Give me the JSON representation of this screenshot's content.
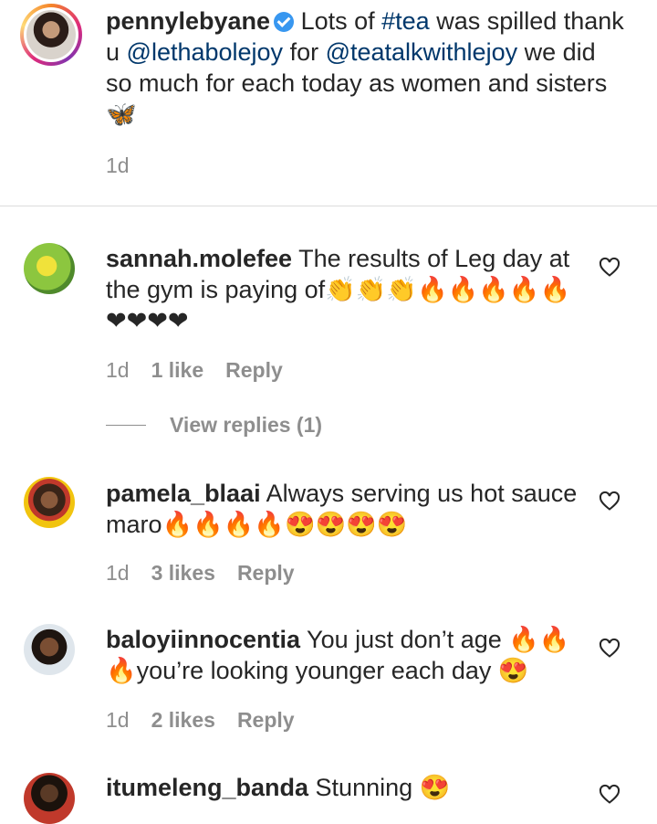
{
  "post": {
    "username": "pennylebyane",
    "caption_part1": " Lots of ",
    "hashtag": "#tea",
    "caption_part2": " was spilled thank u ",
    "mention1": "@lethabolejoy",
    "caption_part3": " for ",
    "mention2": "@teatalkwithlejoy",
    "caption_part4": " we did so much for each today as women and sisters 🦋",
    "time": "1d"
  },
  "comments": [
    {
      "username": "sannah.molefee",
      "text": " The results of Leg day at the gym is paying of👏👏👏🔥🔥🔥🔥🔥❤❤❤❤",
      "time": "1d",
      "likes": "1 like",
      "reply": "Reply",
      "view_replies": "View replies (1)"
    },
    {
      "username": "pamela_blaai",
      "text": " Always serving us hot sauce maro🔥🔥🔥🔥😍😍😍😍",
      "time": "1d",
      "likes": "3 likes",
      "reply": "Reply"
    },
    {
      "username": "baloyiinnocentia",
      "text": " You just don’t age 🔥🔥🔥you’re looking younger each day 😍",
      "time": "1d",
      "likes": "2 likes",
      "reply": "Reply"
    },
    {
      "username": "itumeleng_banda",
      "text": " Stunning 😍"
    }
  ],
  "icons": {
    "verified": "verified-badge-icon",
    "like": "heart-outline-icon"
  },
  "colors": {
    "link": "#00376b",
    "secondary_text": "#8e8e8e",
    "verified": "#3897f0"
  }
}
